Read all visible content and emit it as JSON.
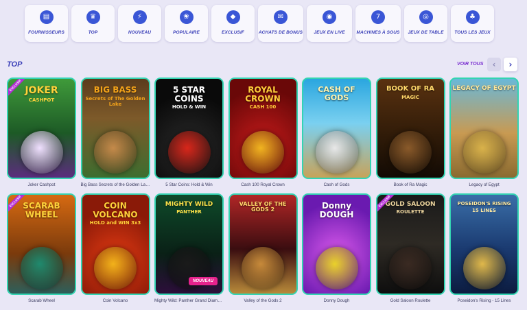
{
  "categories": [
    {
      "label": "FOURNISSEURS",
      "icon": "book-icon",
      "glyph": "▤"
    },
    {
      "label": "TOP",
      "icon": "crown-icon",
      "glyph": "♛"
    },
    {
      "label": "NOUVEAU",
      "icon": "lightning-icon",
      "glyph": "⚡"
    },
    {
      "label": "POPULAIRE",
      "icon": "flame-icon",
      "glyph": "❀"
    },
    {
      "label": "EXCLUSIF",
      "icon": "diamond-icon",
      "glyph": "◆"
    },
    {
      "label": "ACHATS DE BONUS",
      "icon": "gift-icon",
      "glyph": "✉"
    },
    {
      "label": "JEUX EN LIVE",
      "icon": "live-icon",
      "glyph": "◉"
    },
    {
      "label": "MACHINES À SOUS",
      "icon": "slot-machine-icon",
      "glyph": "7"
    },
    {
      "label": "JEUX DE TABLE",
      "icon": "roulette-icon",
      "glyph": "◎"
    },
    {
      "label": "TOUS LES JEUX",
      "icon": "cherries-icon",
      "glyph": "♣"
    }
  ],
  "section": {
    "title": "TOP",
    "see_all": "VOIR TOUS",
    "prev_glyph": "‹",
    "next_glyph": "›"
  },
  "games": [
    {
      "caption": "Joker Cashpot",
      "art_title": "JOKER",
      "art_sub": "CASHPOT",
      "theme": "t-joker",
      "title_color": "#ffd23a",
      "title_size": "14px",
      "art_color": "#f0e0ff",
      "ribbon": "EXCLUSIF"
    },
    {
      "caption": "Big Bass Secrets of the Golden Lake",
      "art_title": "BIG BASS",
      "art_sub": "Secrets of The Golden Lake",
      "theme": "t-bigbass",
      "title_color": "#f2a21a",
      "title_size": "12px",
      "art_color": "#c58a4a"
    },
    {
      "caption": "5 Star Coins: Hold & Win",
      "art_title": "5 STAR COINS",
      "art_sub": "HOLD & WIN",
      "theme": "t-5star",
      "title_color": "#ffffff",
      "title_size": "12px",
      "art_color": "#d8261a"
    },
    {
      "caption": "Cash 100 Royal Crown",
      "art_title": "ROYAL CROWN",
      "art_sub": "CASH 100",
      "theme": "t-royal",
      "title_color": "#ffcc3a",
      "title_size": "12px",
      "art_color": "#f0b420"
    },
    {
      "caption": "Cash of Gods",
      "art_title": "CASH OF GODS",
      "art_sub": "",
      "theme": "t-cash",
      "title_color": "#fff3b0",
      "title_size": "11px",
      "art_color": "#e8e8e8"
    },
    {
      "caption": "Book of Ra Magic",
      "art_title": "BOOK OF RA",
      "art_sub": "MAGIC",
      "theme": "t-bookra",
      "title_color": "#ffd86a",
      "title_size": "10px",
      "art_color": "#8a5a2a"
    },
    {
      "caption": "Legacy of Egypt",
      "art_title": "LEGACY OF EGYPT",
      "art_sub": "",
      "theme": "t-legacy",
      "title_color": "#ffe79a",
      "title_size": "9px",
      "art_color": "#d9b24a"
    },
    {
      "caption": "Scarab Wheel",
      "art_title": "SCARAB WHEEL",
      "art_sub": "",
      "theme": "t-scarab",
      "title_color": "#ffd23a",
      "title_size": "12px",
      "art_color": "#1f8a6e",
      "ribbon": "EXCLUSIF"
    },
    {
      "caption": "Coin Volcano",
      "art_title": "COIN VOLCANO",
      "art_sub": "HOLD and WIN 3x3",
      "theme": "t-volcano",
      "title_color": "#ffd23a",
      "title_size": "12px",
      "art_color": "#f2b21a"
    },
    {
      "caption": "Mighty Wild: Panther Grand Diamond ...",
      "art_title": "MIGHTY WILD",
      "art_sub": "PANTHER",
      "theme": "t-panther",
      "title_color": "#ffe34a",
      "title_size": "9px",
      "art_color": "#1a1a1a",
      "badge": "NOUVEAU"
    },
    {
      "caption": "Valley of the Gods 2",
      "art_title": "VALLEY OF THE GODS 2",
      "art_sub": "",
      "theme": "t-valley",
      "title_color": "#ffd86a",
      "title_size": "8px",
      "art_color": "#c78a3a"
    },
    {
      "caption": "Donny Dough",
      "art_title": "Donny DOUGH",
      "art_sub": "",
      "theme": "t-donny",
      "title_color": "#ffffff",
      "title_size": "12px",
      "art_color": "#e9d12a"
    },
    {
      "caption": "Gold Saloon Roulette",
      "art_title": "GOLD SALOON",
      "art_sub": "ROULETTE",
      "theme": "t-gold",
      "title_color": "#f0d8a0",
      "title_size": "9px",
      "art_color": "#3a2a22",
      "ribbon": "EXCLUSIF"
    },
    {
      "caption": "Poseidon's Rising - 15 Lines",
      "art_title": "POSEIDON'S RISING",
      "art_sub": "15 LINES",
      "theme": "t-poseidon",
      "title_color": "#ffe9a0",
      "title_size": "7px",
      "art_color": "#e0b84a"
    }
  ]
}
